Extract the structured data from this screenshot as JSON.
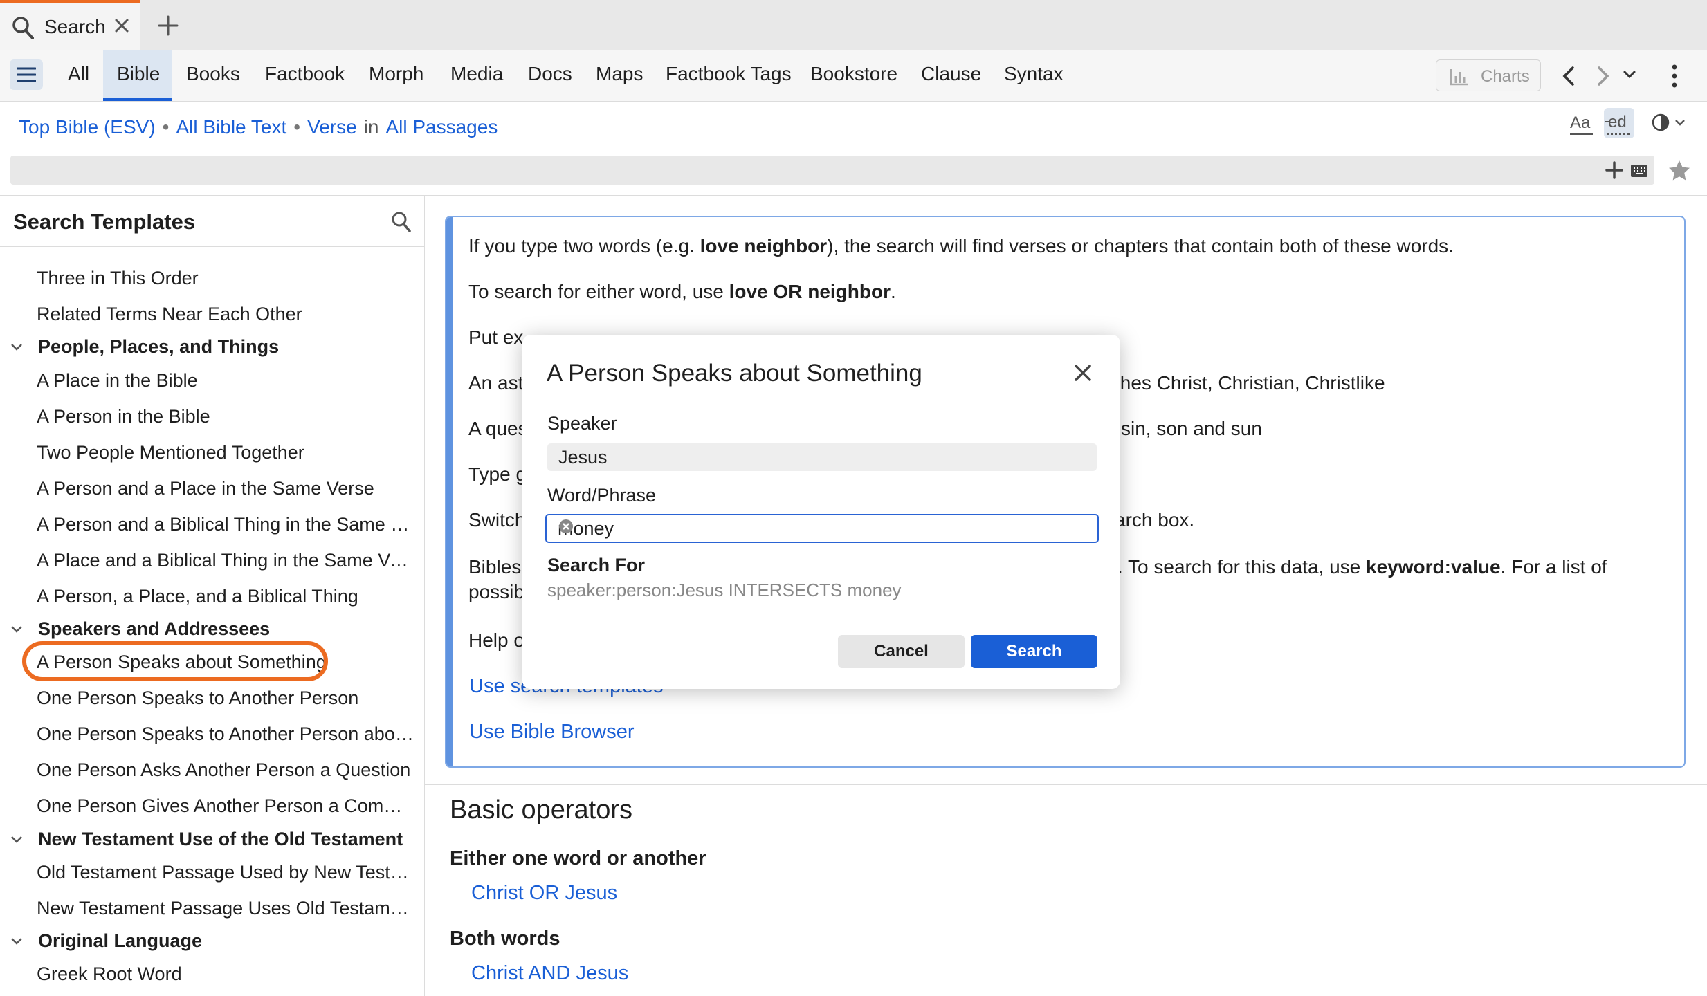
{
  "colors": {
    "accent": "#1a5fd6",
    "highlight": "#ec6b21"
  },
  "tab": {
    "label": "Search"
  },
  "toolbar": {
    "tabs": [
      "All",
      "Bible",
      "Books",
      "Factbook",
      "Morph",
      "Media",
      "Docs",
      "Maps",
      "Factbook Tags",
      "Bookstore",
      "Clause",
      "Syntax"
    ],
    "active_tab": "Bible",
    "charts_label": "Charts"
  },
  "breadcrumb": {
    "bible": "Top Bible (ESV)",
    "text": "All Bible Text",
    "unit": "Verse",
    "in": "in",
    "passages": "All Passages",
    "sep": "•"
  },
  "left": {
    "title": "Search Templates",
    "items": {
      "i0": "Three in This Order",
      "i1": "Related Terms Near Each Other",
      "c1": "People, Places, and Things",
      "i2": "A Place in the Bible",
      "i3": "A Person in the Bible",
      "i4": "Two People Mentioned Together",
      "i5": "A Person and a Place in the Same Verse",
      "i6": "A Person and a Biblical Thing in the Same Ve…",
      "i7": "A Place and a Biblical Thing in the Same Verse",
      "i8": "A Person, a Place, and a Biblical Thing",
      "c2": "Speakers and Addressees",
      "i9": "A Person Speaks about Something",
      "i10": "One Person Speaks to Another Person",
      "i11": "One Person Speaks to Another Person about…",
      "i12": "One Person Asks Another Person a Question",
      "i13": "One Person Gives Another Person a Command",
      "c3": "New Testament Use of the Old Testament",
      "i14": "Old Testament Passage Used by New Testam…",
      "i15": "New Testament Passage Uses Old Testament",
      "c4": "Original Language",
      "i16": "Greek Root Word"
    }
  },
  "info": {
    "line1_a": "If you type two words (e.g. ",
    "line1_b": "love neighbor",
    "line1_c": "), the search will find verses or chapters that contain both of these words.",
    "line2_a": "To search for either word, use ",
    "line2_b": "love OR neighbor",
    "line2_c": ".",
    "line3": "Put ex",
    "line4": "An ast",
    "line4_right": "tches Christ, Christian, Christlike",
    "line5": "A ques",
    "line5_right": "sin, son and sun",
    "line6": "Type g",
    "line7": "Switch",
    "line7_right": "arch box.",
    "line8": "Bibles",
    "line8_right_a": ". To search for this data, use ",
    "line8_right_b": "keyword:value",
    "line8_right_c": ". For a list of",
    "line9": "possib",
    "line10": "Help o",
    "link1": "Use search templates",
    "link2": "Use Bible Browser"
  },
  "operators": {
    "title": "Basic operators",
    "either_head": "Either one word or another",
    "either_example": "Christ OR Jesus",
    "both_head": "Both words",
    "both_example": "Christ AND Jesus"
  },
  "dialog": {
    "title": "A Person Speaks about Something",
    "speaker_label": "Speaker",
    "speaker_value": "Jesus",
    "word_label": "Word/Phrase",
    "word_value": "money",
    "search_for_label": "Search For",
    "search_for_value": "speaker:person:Jesus INTERSECTS money",
    "cancel": "Cancel",
    "search": "Search"
  }
}
